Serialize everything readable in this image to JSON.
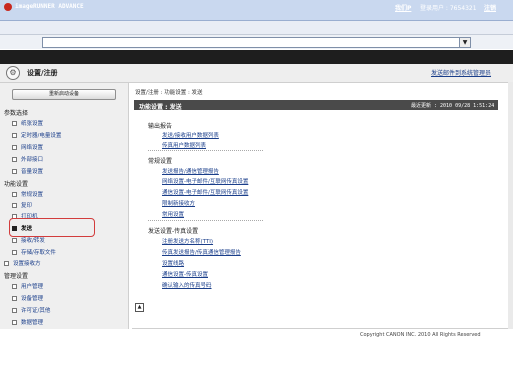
{
  "browser": {
    "dropdown_glyph": "▼"
  },
  "header": {
    "app_name": "imageRUNNER ADVANCE",
    "my_page": "我们P",
    "login_user": "登录用户 : 7654321",
    "logout": "注销"
  },
  "subheader": {
    "title": "设置/注册",
    "mail_link": "发送邮件到系统管理员",
    "icon": "settings-icon"
  },
  "sidebar": {
    "remote_button": "重新启动设备",
    "sections": [
      {
        "label": "参数选择",
        "items": [
          "纸张设置",
          "定时器/电量设置",
          "网络设置",
          "外部接口",
          "音量设置"
        ]
      },
      {
        "label": "功能设置",
        "items": [
          "常规设置",
          "复印",
          "打印机",
          "发送",
          "接收/转发",
          "存储/存取文件"
        ]
      },
      {
        "label": "设置接收方",
        "items": []
      },
      {
        "label": "管理设置",
        "items": [
          "用户管理",
          "设备管理",
          "许可证/其他",
          "数据管理"
        ]
      }
    ],
    "active_item": "发送"
  },
  "main": {
    "breadcrumb": "设置/注册 : 功能设置 : 发送",
    "bar_title": "功能设置 : 发送",
    "bar_time": "最近更新 : 2010 09/28 1:51:24",
    "sections": [
      {
        "title": "输出报告",
        "links": [
          "发送/接收用户数据列表",
          "传真用户数据列表"
        ]
      },
      {
        "title": "常规设置",
        "links": [
          "发送报告/通信管理报告",
          "网络设置-电子邮件/互联网传真设置",
          "通信设置-电子邮件/互联网传真设置",
          "限制新接收方",
          "常用设置"
        ]
      },
      {
        "title": "发送设置-传真设置",
        "links": [
          "注册发送方名称(TTI)",
          "传真发送报告/传真通信管理报告",
          "设置线路",
          "通信设置-传真设置",
          "确认输入的传真号码"
        ]
      }
    ],
    "scroll_top_glyph": "▲",
    "copyright": "Copyright CANON INC. 2010 All Rights Reserved"
  },
  "colors": {
    "header_bg": "#1e1e1e",
    "link": "#1a3e8a",
    "highlight": "#d23c3c",
    "bar": "#4a4a4a"
  }
}
